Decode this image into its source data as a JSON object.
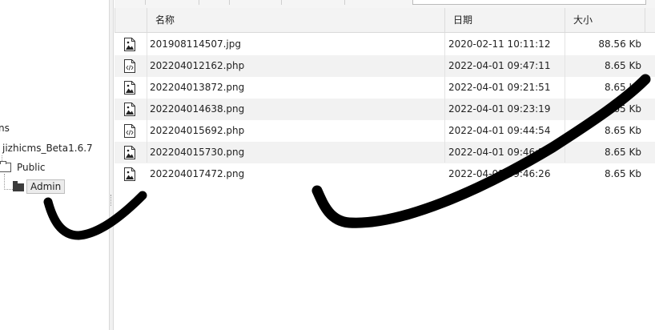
{
  "tree": {
    "partial_label": "ns",
    "root_label": "jizhicms_Beta1.6.7",
    "public_label": "Public",
    "admin_label": "Admin"
  },
  "columns": {
    "name": "名称",
    "date": "日期",
    "size": "大小"
  },
  "files": [
    {
      "name": "201908114507.jpg",
      "date": "2020-02-11 10:11:12",
      "size": "88.56 Kb",
      "icon": "image-file-icon"
    },
    {
      "name": "202204012162.php",
      "date": "2022-04-01 09:47:11",
      "size": "8.65 Kb",
      "icon": "code-file-icon"
    },
    {
      "name": "202204013872.png",
      "date": "2022-04-01 09:21:51",
      "size": "8.65 Kb",
      "icon": "image-file-icon"
    },
    {
      "name": "202204014638.png",
      "date": "2022-04-01 09:23:19",
      "size": "8.65 Kb",
      "icon": "image-file-icon"
    },
    {
      "name": "202204015692.php",
      "date": "2022-04-01 09:44:54",
      "size": "8.65 Kb",
      "icon": "code-file-icon"
    },
    {
      "name": "202204015730.png",
      "date": "2022-04-01 09:46:25",
      "size": "8.65 Kb",
      "icon": "image-file-icon"
    },
    {
      "name": "202204017472.png",
      "date": "2022-04-01 09:46:26",
      "size": "8.65 Kb",
      "icon": "image-file-icon"
    }
  ],
  "colors": {
    "annotation_stroke": "#000000",
    "alt_row": "#f2f2f2"
  }
}
